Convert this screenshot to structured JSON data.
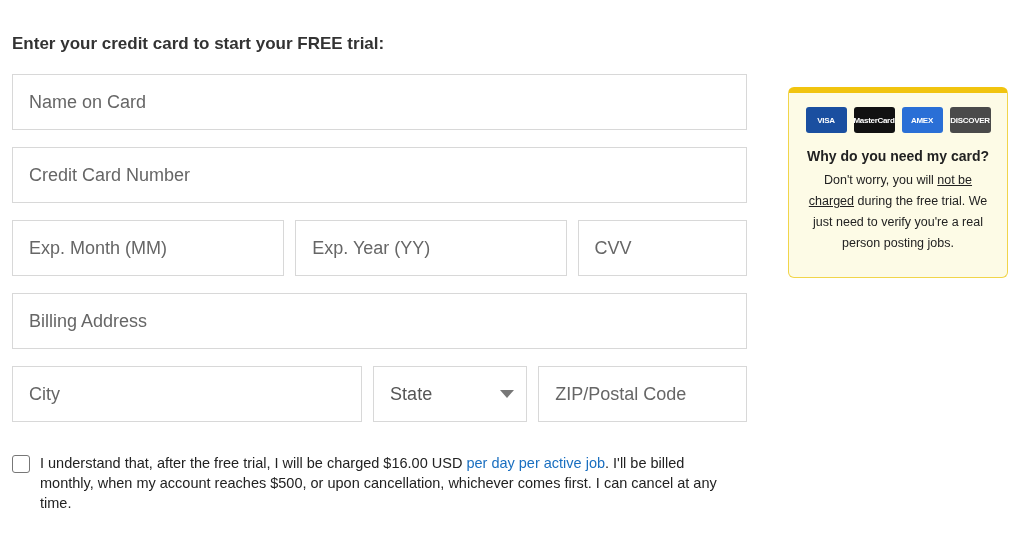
{
  "heading": "Enter your credit card to start your FREE trial:",
  "field_rows": [
    {
      "fields": [
        {
          "kind": "text",
          "placeholder": "Name on Card"
        }
      ]
    },
    {
      "fields": [
        {
          "kind": "text",
          "placeholder": "Credit Card Number"
        }
      ]
    },
    {
      "fields": [
        {
          "kind": "text",
          "placeholder": "Exp. Month (MM)"
        },
        {
          "kind": "text",
          "placeholder": "Exp. Year (YY)"
        },
        {
          "kind": "text",
          "placeholder": "CVV"
        }
      ]
    },
    {
      "fields": [
        {
          "kind": "text",
          "placeholder": "Billing Address"
        }
      ]
    },
    {
      "fields": [
        {
          "kind": "text",
          "placeholder": "City"
        },
        {
          "kind": "select",
          "placeholder": "State"
        },
        {
          "kind": "text",
          "placeholder": "ZIP/Postal Code"
        }
      ]
    }
  ],
  "agreement": {
    "checked": false,
    "before": "I understand that, after the free trial, I will be charged $16.00 USD ",
    "link": "per day per active job",
    "after": ". I'll be billed monthly, when my account reaches $500, or upon cancellation, whichever comes first. I can cancel at any time."
  },
  "info_box": {
    "cards": [
      {
        "label": "VISA",
        "color": "#1a4fa0"
      },
      {
        "label": "MasterCard",
        "color": "#111111"
      },
      {
        "label": "AMEX",
        "color": "#2a6fd6"
      },
      {
        "label": "DISCOVER",
        "color": "#4a4a4a"
      }
    ],
    "title": "Why do you need my card?",
    "text": [
      {
        "text": "Don't worry, you will ",
        "underlined": false
      },
      {
        "text": "not be charged",
        "underlined": true
      },
      {
        "text": " during the free trial. We just need to verify you're a real person posting jobs.",
        "underlined": false
      }
    ]
  }
}
